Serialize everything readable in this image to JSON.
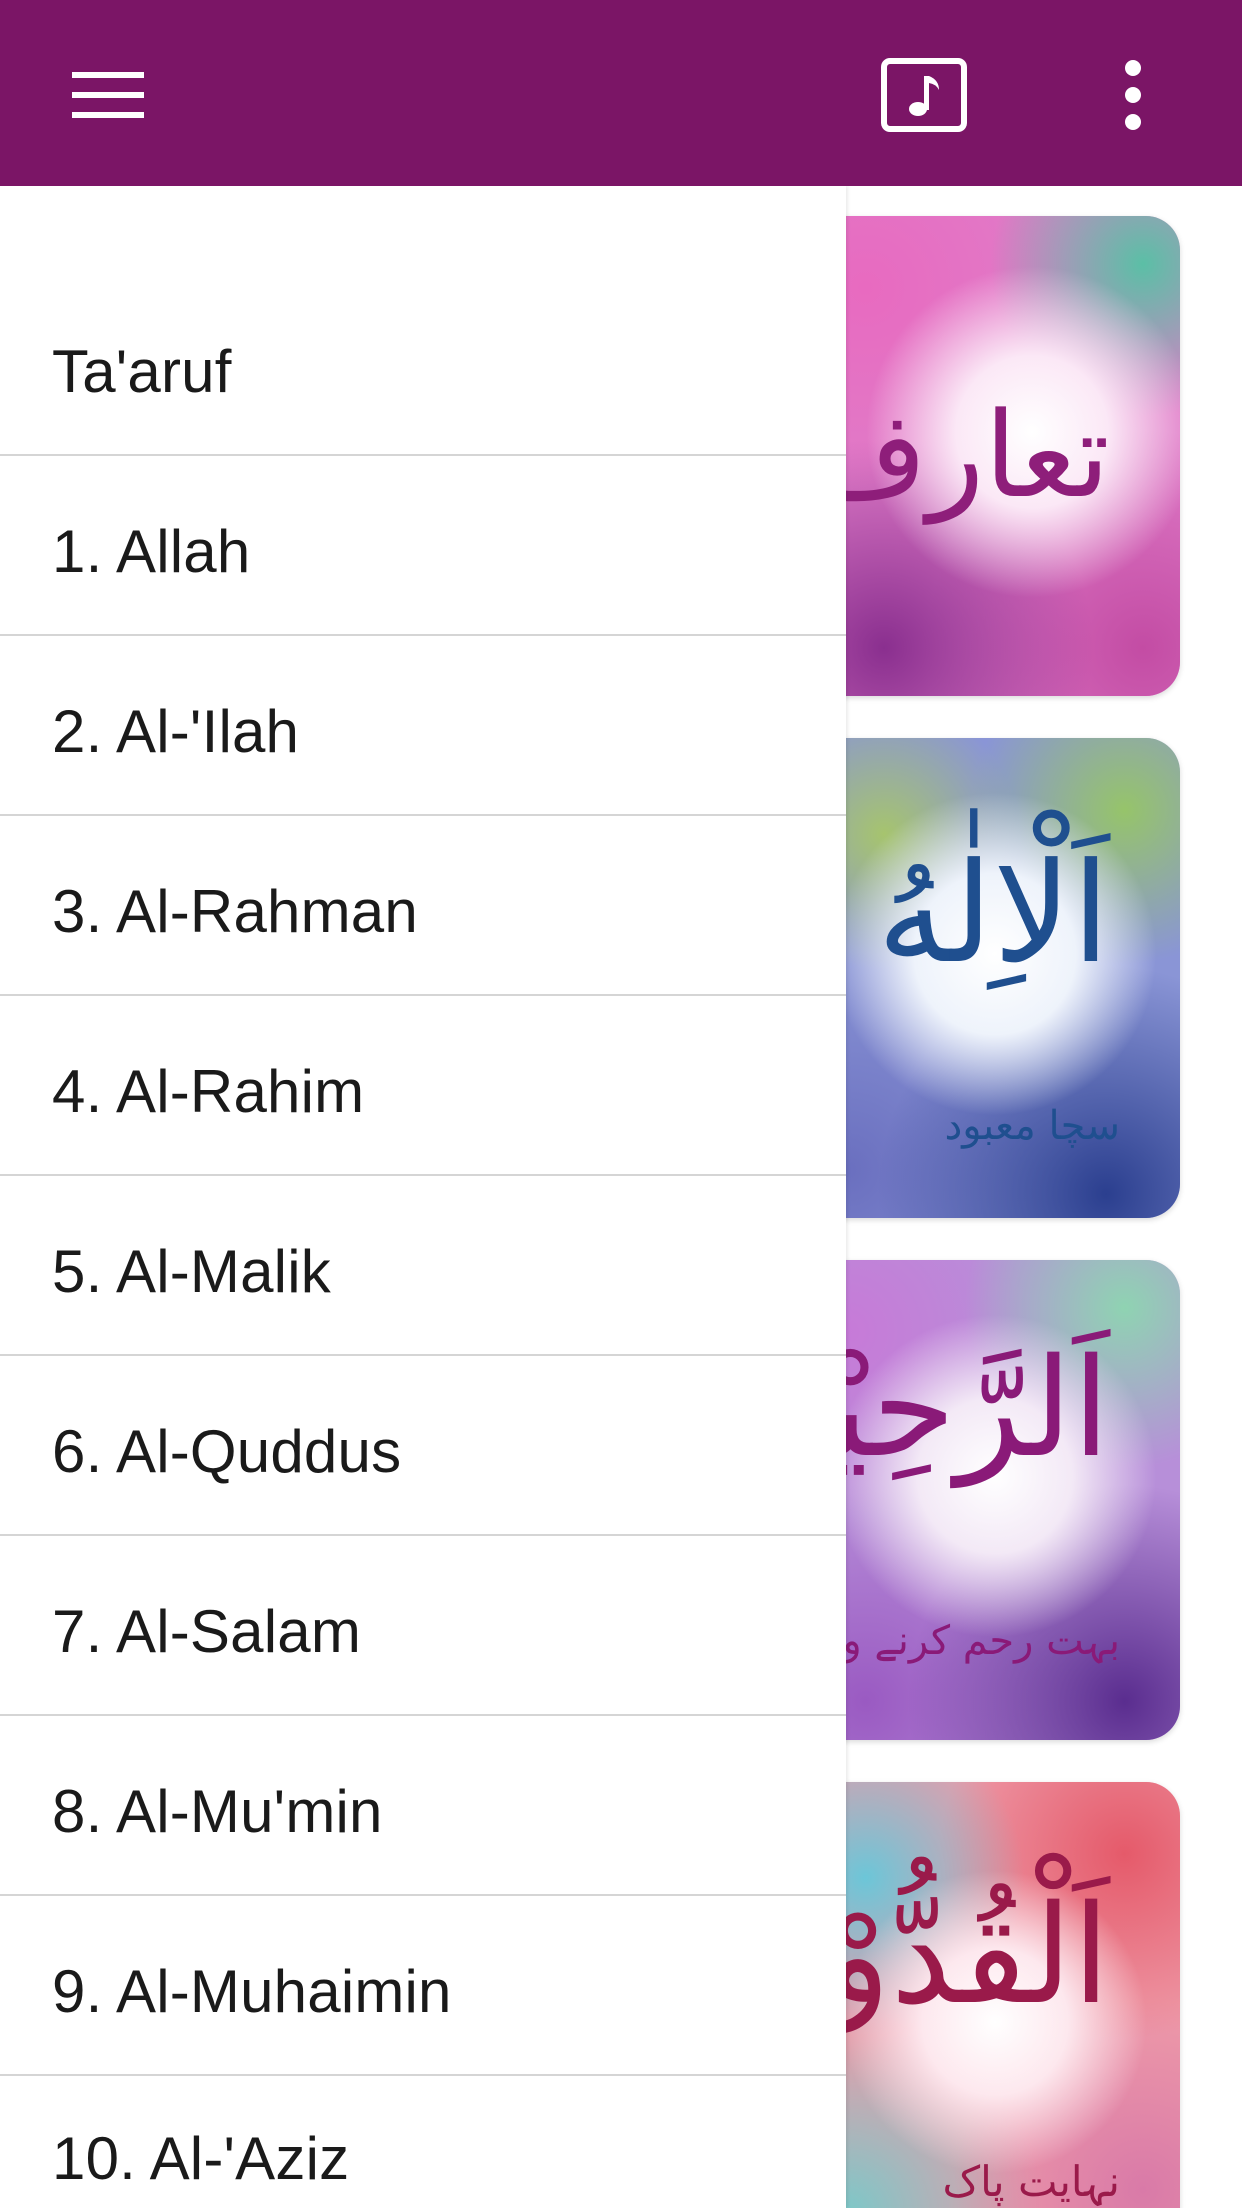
{
  "toolbar": {
    "menu_icon": "hamburger-menu-icon",
    "music_icon": "music-note-icon",
    "more_icon": "more-vertical-icon",
    "background": "#7b1566"
  },
  "drawer": {
    "items": [
      {
        "label": "Ta'aruf"
      },
      {
        "label": "1. Allah"
      },
      {
        "label": "2. Al-'Ilah"
      },
      {
        "label": "3. Al-Rahman"
      },
      {
        "label": "4. Al-Rahim"
      },
      {
        "label": "5. Al-Malik"
      },
      {
        "label": "6. Al-Quddus"
      },
      {
        "label": "7. Al-Salam"
      },
      {
        "label": "8. Al-Mu'min"
      },
      {
        "label": "9. Al-Muhaimin"
      },
      {
        "label": "10. Al-'Aziz"
      }
    ]
  },
  "cards": [
    {
      "arabic": "تعارف",
      "urdu": "",
      "accent": "#8e1e7a"
    },
    {
      "arabic": "اَلْاِلٰهُ",
      "urdu": "سچا معبود",
      "accent": "#1f4f8f"
    },
    {
      "arabic": "اَلرَّحِيْمُ",
      "urdu": "بہت رحم کرنے والا",
      "accent": "#8a1a78"
    },
    {
      "arabic": "اَلْقُدُّوْسُ",
      "urdu": "نہایت پاک",
      "accent": "#9a1a4a"
    }
  ]
}
